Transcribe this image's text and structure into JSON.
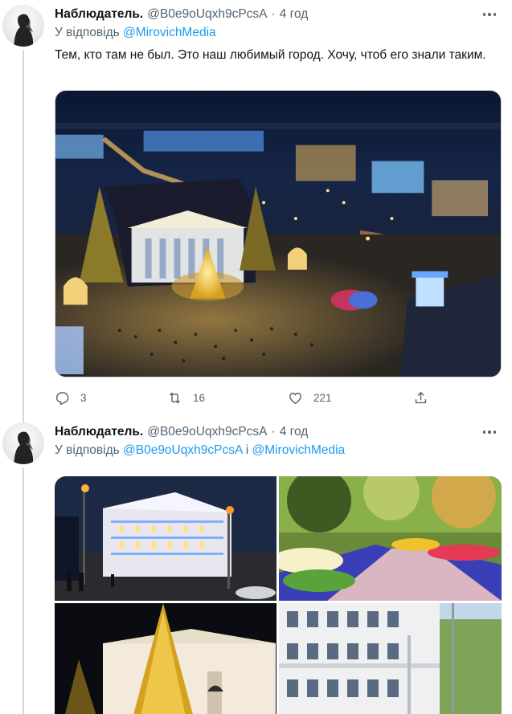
{
  "tweets": [
    {
      "author_name": "Наблюдатель.",
      "author_handle": "@B0e9oUqxh9cPcsA",
      "separator": "·",
      "time": "4 год",
      "reply_prefix": "У відповідь",
      "reply_mentions": [
        "@MirovichMedia"
      ],
      "text": "Тем, кто там не был. Это наш любимый город. Хочу, чтоб его знали таким.",
      "stats": {
        "replies": "3",
        "retweets": "16",
        "likes": "221"
      }
    },
    {
      "author_name": "Наблюдатель.",
      "author_handle": "@B0e9oUqxh9cPcsA",
      "separator": "·",
      "time": "4 год",
      "reply_prefix": "У відповідь",
      "reply_mentions": [
        "@B0e9oUqxh9cPcsA",
        "@MirovichMedia"
      ],
      "reply_joiner": "і"
    }
  ],
  "colors": {
    "text_primary": "#0f1419",
    "text_secondary": "#536471",
    "accent": "#1d9bf0",
    "divider": "#cfd9de"
  },
  "icons": [
    "more-icon",
    "reply-icon",
    "retweet-icon",
    "like-icon",
    "share-icon"
  ]
}
